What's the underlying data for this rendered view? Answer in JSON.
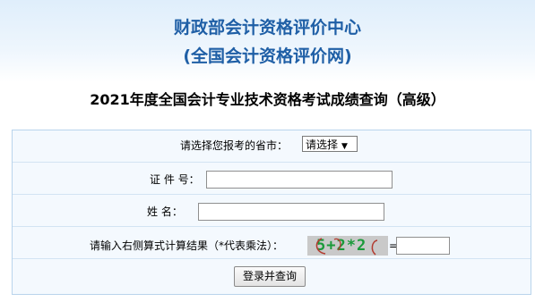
{
  "header": {
    "org_name": "财政部会计资格评价中心",
    "org_subtitle": "(全国会计资格评价网)"
  },
  "exam_title": "2021年度全国会计专业技术资格考试成绩查询（高级）",
  "form": {
    "province": {
      "label": "请选择您报考的省市：",
      "selected": "请选择"
    },
    "id_number": {
      "label": "证 件 号：",
      "value": ""
    },
    "name": {
      "label": "姓  名：",
      "value": ""
    },
    "captcha": {
      "label": "请输入右侧算式计算结果（*代表乘法）：",
      "image_text": "5+2*2",
      "equals": "=",
      "value": ""
    },
    "submit_label": "登录并查询"
  },
  "colors": {
    "title_blue": "#1f5fa6",
    "form_background": "#f4f9fe",
    "form_border": "#b9d4ec",
    "captcha_text": "#1a9a3a"
  },
  "icons": {
    "select_arrow": "triangle-down-icon"
  }
}
